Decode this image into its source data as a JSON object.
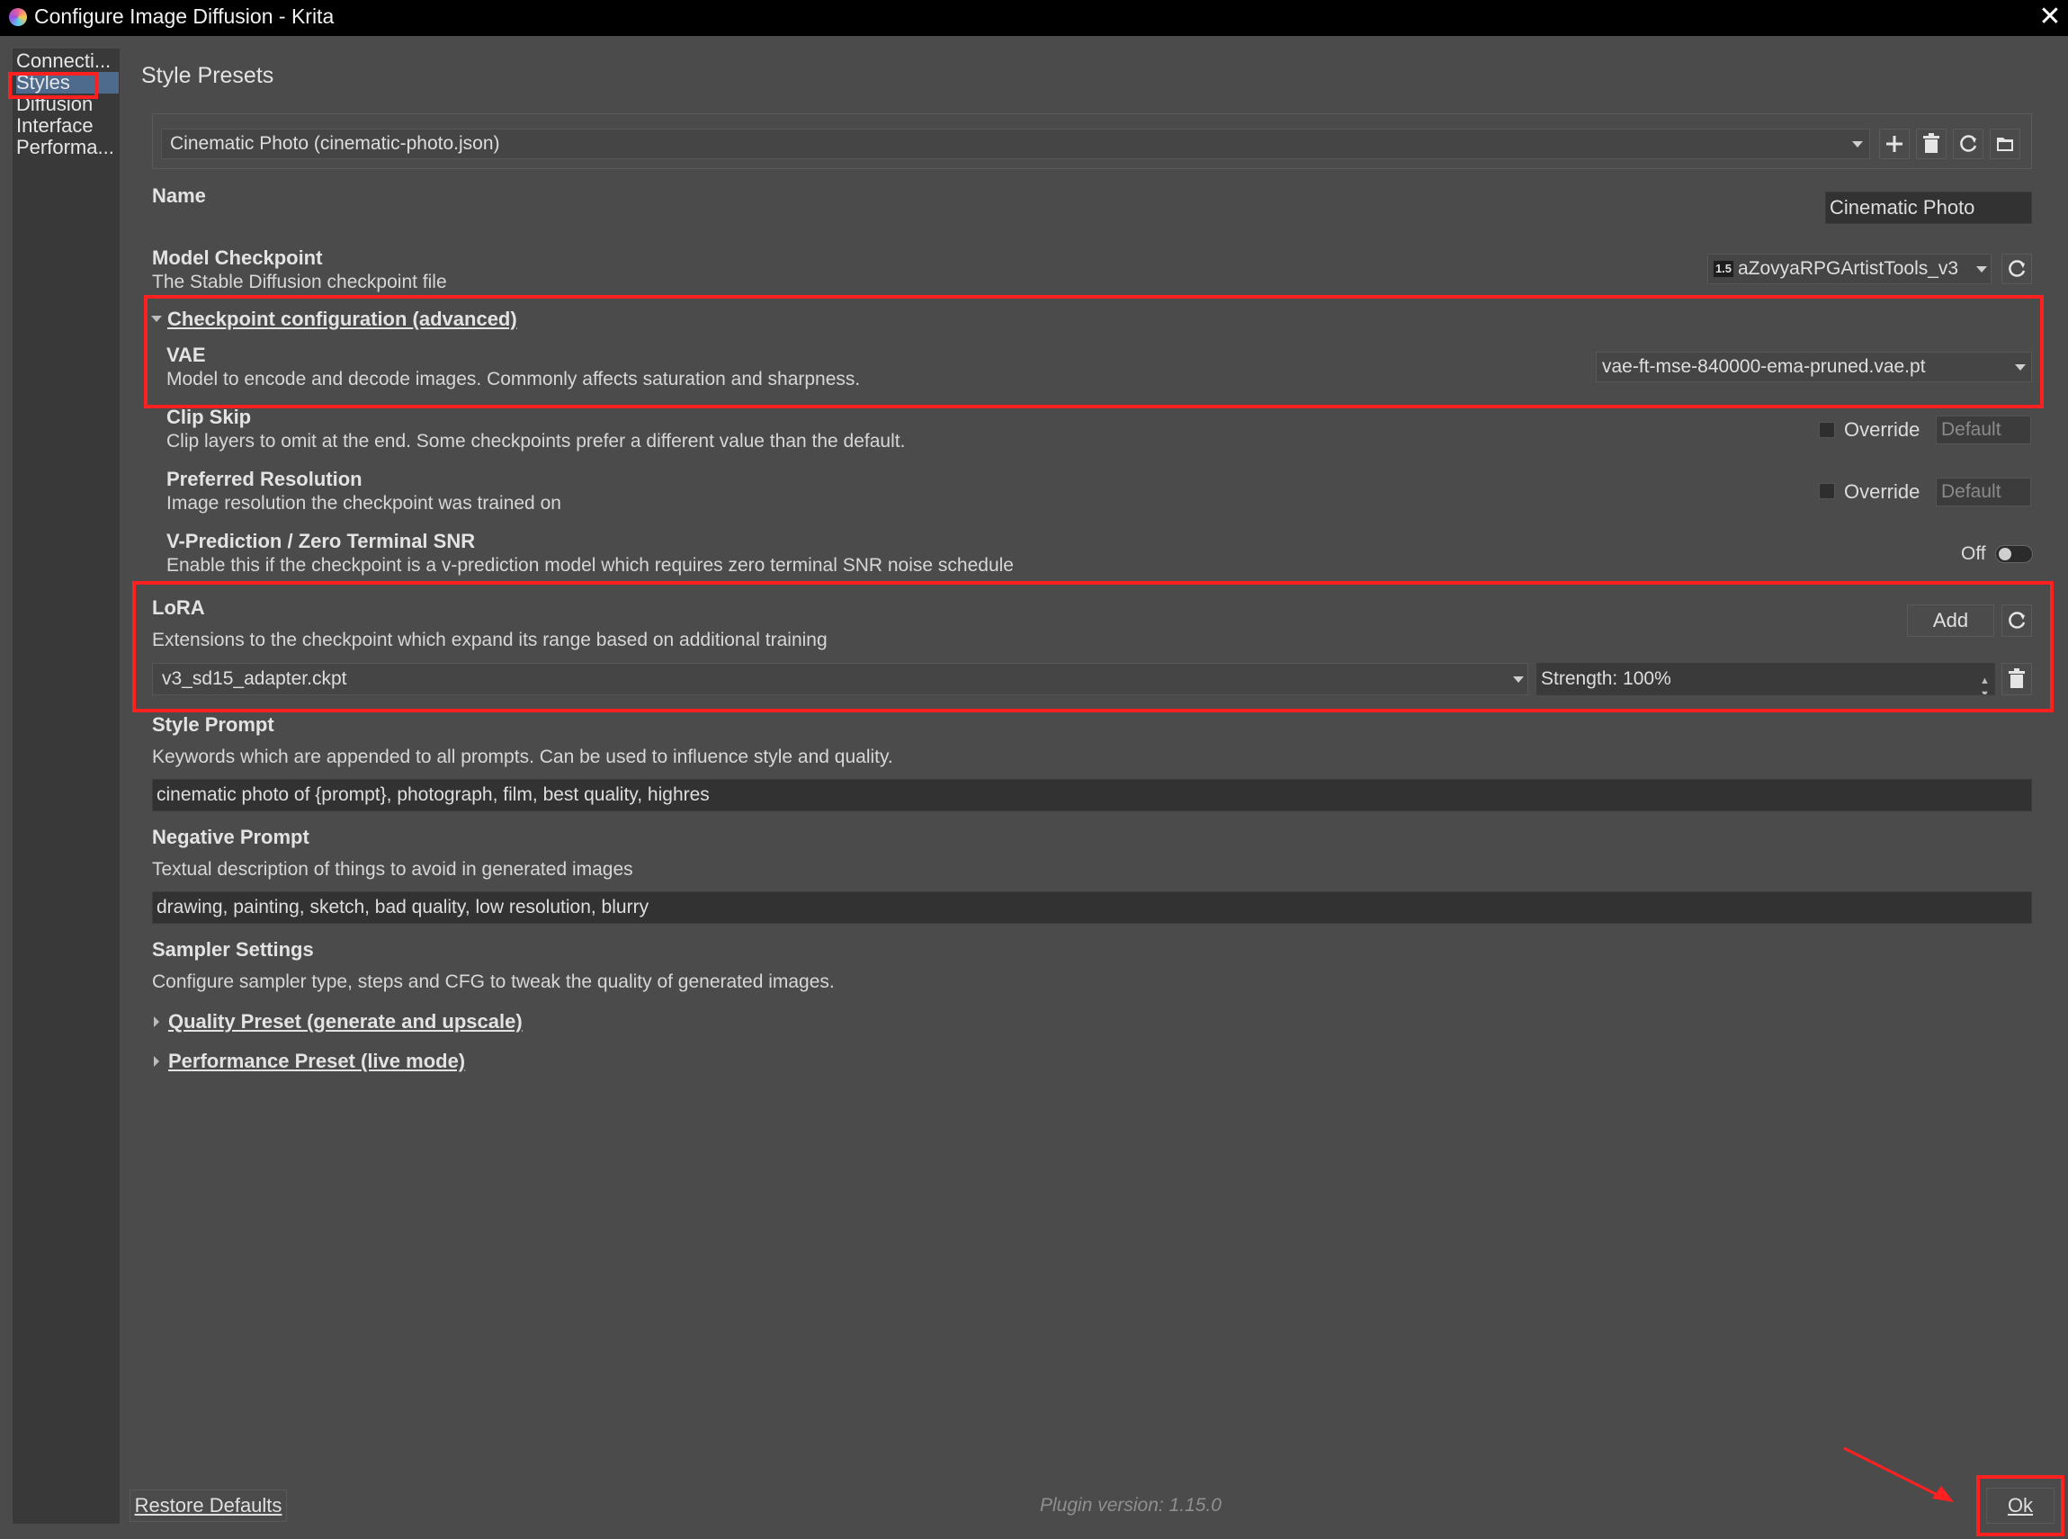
{
  "window": {
    "title": "Configure Image Diffusion - Krita",
    "close_glyph": "✕"
  },
  "sidebar": {
    "items": [
      {
        "label": "Connecti..."
      },
      {
        "label": "Styles"
      },
      {
        "label": "Diffusion"
      },
      {
        "label": "Interface"
      },
      {
        "label": "Performa..."
      }
    ]
  },
  "page": {
    "title": "Style Presets"
  },
  "preset": {
    "selected": "Cinematic Photo (cinematic-photo.json)"
  },
  "name": {
    "label": "Name",
    "value": "Cinematic Photo"
  },
  "checkpoint": {
    "label": "Model Checkpoint",
    "desc": "The Stable Diffusion checkpoint file",
    "badge": "1.5",
    "value": "aZovyaRPGArtistTools_v3"
  },
  "ckpt_config": {
    "label": "Checkpoint configuration (advanced)"
  },
  "vae": {
    "label": "VAE",
    "desc": "Model to encode and decode images. Commonly affects saturation and sharpness.",
    "value": "vae-ft-mse-840000-ema-pruned.vae.pt"
  },
  "clip_skip": {
    "label": "Clip Skip",
    "desc": "Clip layers to omit at the end. Some checkpoints prefer a different value than the default.",
    "override_label": "Override",
    "value": "Default"
  },
  "resolution": {
    "label": "Preferred Resolution",
    "desc": "Image resolution the checkpoint was trained on",
    "override_label": "Override",
    "value": "Default"
  },
  "vpred": {
    "label": "V-Prediction / Zero Terminal SNR",
    "desc": "Enable this if the checkpoint is a v-prediction model which requires zero terminal SNR noise schedule",
    "state": "Off"
  },
  "lora": {
    "label": "LoRA",
    "desc": "Extensions to the checkpoint which expand its range based on additional training",
    "add_label": "Add",
    "file": "v3_sd15_adapter.ckpt",
    "strength": "Strength: 100%"
  },
  "style_prompt": {
    "label": "Style Prompt",
    "desc": "Keywords which are appended to all prompts. Can be used to influence style and quality.",
    "value": "cinematic photo of {prompt}, photograph, film, best quality, highres"
  },
  "negative_prompt": {
    "label": "Negative Prompt",
    "desc": "Textual description of things to avoid in generated images",
    "value": "drawing, painting, sketch, bad quality, low resolution, blurry"
  },
  "sampler": {
    "label": "Sampler Settings",
    "desc": "Configure sampler type, steps and CFG to tweak the quality of generated images.",
    "quality_preset": "Quality Preset (generate and upscale)",
    "performance_preset": "Performance Preset (live mode)"
  },
  "footer": {
    "restore": "Restore Defaults",
    "version": "Plugin version: 1.15.0",
    "ok": "Ok"
  },
  "colors": {
    "highlight": "#ff2020",
    "selection": "#4e6a8c",
    "background": "#4b4b4b"
  }
}
